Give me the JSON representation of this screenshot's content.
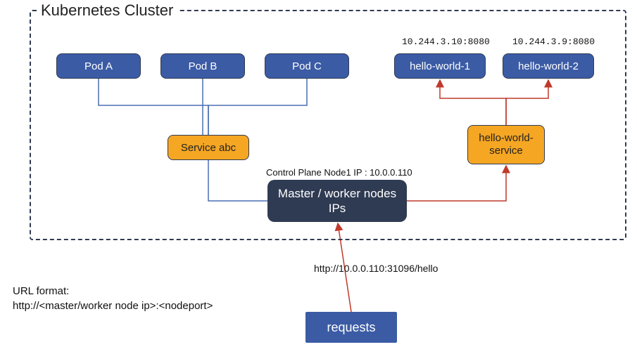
{
  "cluster_title": "Kubernetes Cluster",
  "pods": {
    "a": "Pod A",
    "b": "Pod B",
    "c": "Pod C",
    "hw1": "hello-world-1",
    "hw2": "hello-world-2"
  },
  "pod_ips": {
    "hw1": "10.244.3.10:8080",
    "hw2": "10.244.3.9:8080"
  },
  "services": {
    "abc": "Service abc",
    "hw": "hello-world-service"
  },
  "control_plane_label": "Control Plane Node1 IP : 10.0.0.110",
  "master_label": "Master / worker nodes IPs",
  "request_url": "http://10.0.0.110:31096/hello",
  "requests_label": "requests",
  "url_format_title": "URL format:",
  "url_format_value": "http://<master/worker node ip>:<nodeport>",
  "colors": {
    "pod": "#3b5ba5",
    "service": "#f5a623",
    "master": "#2f3b52",
    "arrow_red": "#c0392b",
    "line_blue": "#4a6fb3"
  }
}
